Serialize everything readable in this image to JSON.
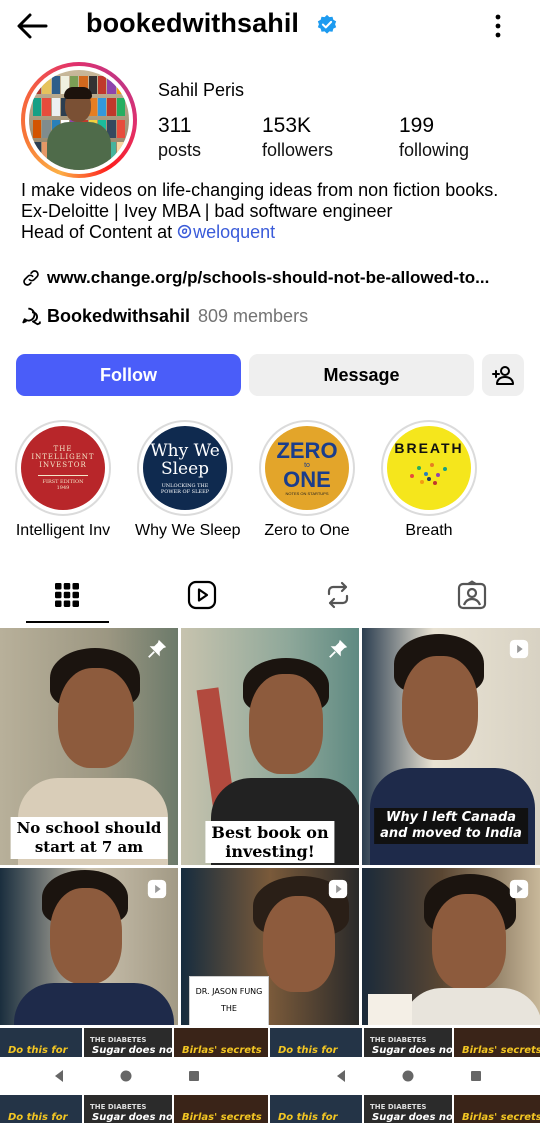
{
  "header": {
    "username": "bookedwithsahil"
  },
  "profile": {
    "display_name": "Sahil Peris",
    "stats": [
      {
        "value": "311",
        "label": "posts"
      },
      {
        "value": "153K",
        "label": "followers"
      },
      {
        "value": "199",
        "label": "following"
      }
    ],
    "bio_line1": "I make videos on life-changing ideas from non fiction books.",
    "bio_line2": "Ex-Deloitte | Ivey MBA | bad software engineer",
    "bio_line3_prefix": "Head of Content at ",
    "bio_mention": "weloquent",
    "link": "www.change.org/p/schools-should-not-be-allowed-to...",
    "channel_name": "Bookedwithsahil",
    "channel_members": "809 members"
  },
  "actions": {
    "follow": "Follow",
    "message": "Message"
  },
  "highlights": [
    {
      "label": "Intelligent Inv",
      "cover": [
        "THE",
        "INTELLIGENT",
        "INVESTOR",
        "FIRST EDITION",
        "1949"
      ]
    },
    {
      "label": "Why We Sleep",
      "cover": [
        "Why We",
        "Sleep",
        "UNLOCKING THE",
        "POWER OF SLEEP"
      ]
    },
    {
      "label": "Zero to One",
      "cover": [
        "ZERO",
        "to",
        "ONE",
        "NOTES ON STARTUPS"
      ]
    },
    {
      "label": "Breath",
      "cover": [
        "BREATH"
      ]
    }
  ],
  "tabs": [
    "posts-grid",
    "reels",
    "reposts",
    "tagged"
  ],
  "posts": [
    {
      "caption": "No school should\nstart at 7 am"
    },
    {
      "caption": "Best book on\ninvesting!"
    },
    {
      "caption": "Why I left Canada\nand moved to India"
    },
    {
      "book_text": "DR. JASON FUNG",
      "book_text2": "THE"
    }
  ],
  "strip": [
    {
      "text": "Do this for"
    },
    {
      "text": "THE DIABETES",
      "sub": "Sugar does not"
    },
    {
      "text": "Birlas' secrets"
    }
  ],
  "colors": {
    "accent": "#4a5df9",
    "link": "#3a5bd9",
    "verified": "#1d9bf0"
  }
}
